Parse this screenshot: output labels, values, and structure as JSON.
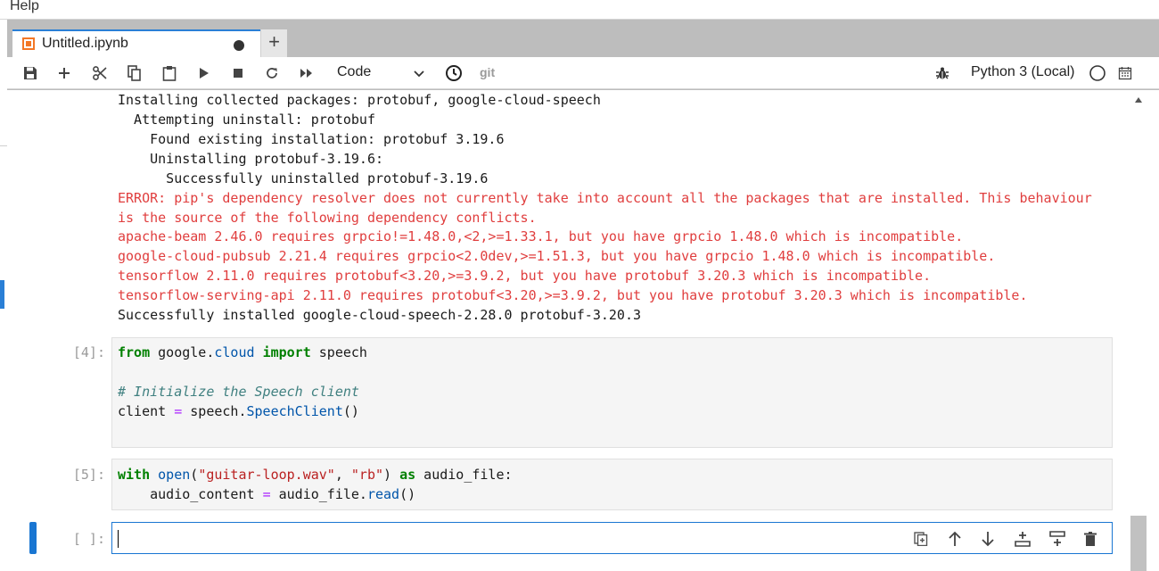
{
  "menu": {
    "help": "Help"
  },
  "tab": {
    "title": "Untitled.ipynb"
  },
  "toolbar": {
    "save": "save-icon",
    "add": "plus-icon",
    "cut": "scissors-icon",
    "copy": "copy-icon",
    "paste": "paste-icon",
    "run": "run-icon",
    "stop": "stop-icon",
    "restart": "restart-icon",
    "run_all": "fast-forward-icon",
    "cell_type": "Code",
    "git": "git",
    "kernel": "Python 3 (Local)"
  },
  "output": {
    "normal_lines": [
      "Installing collected packages: protobuf, google-cloud-speech",
      "  Attempting uninstall: protobuf",
      "    Found existing installation: protobuf 3.19.6",
      "    Uninstalling protobuf-3.19.6:",
      "      Successfully uninstalled protobuf-3.19.6"
    ],
    "error_lines": [
      "ERROR: pip's dependency resolver does not currently take into account all the packages that are installed. This behaviour",
      "is the source of the following dependency conflicts.",
      "apache-beam 2.46.0 requires grpcio!=1.48.0,<2,>=1.33.1, but you have grpcio 1.48.0 which is incompatible.",
      "google-cloud-pubsub 2.21.4 requires grpcio<2.0dev,>=1.51.3, but you have grpcio 1.48.0 which is incompatible.",
      "tensorflow 2.11.0 requires protobuf<3.20,>=3.9.2, but you have protobuf 3.20.3 which is incompatible.",
      "tensorflow-serving-api 2.11.0 requires protobuf<3.20,>=3.9.2, but you have protobuf 3.20.3 which is incompatible."
    ],
    "final_line": "Successfully installed google-cloud-speech-2.28.0 protobuf-3.20.3"
  },
  "cells": {
    "cell4": {
      "prompt": "[4]:",
      "l1": {
        "kw1": "from",
        "a": " google.",
        "nm1": "cloud",
        "b": " ",
        "kw2": "import",
        "c": " speech"
      },
      "comment": "# Initialize the Speech client",
      "l3": {
        "a": "client ",
        "op": "=",
        "b": " speech.",
        "nm": "SpeechClient",
        "c": "()"
      }
    },
    "cell5": {
      "prompt": "[5]:",
      "l1": {
        "kw1": "with",
        "a": " ",
        "nm1": "open",
        "b": "(",
        "s1": "\"guitar-loop.wav\"",
        "c": ", ",
        "s2": "\"rb\"",
        "d": ") ",
        "kw2": "as",
        "e": " audio_file:"
      },
      "l2": {
        "a": "    audio_content ",
        "op": "=",
        "b": " audio_file.",
        "nm": "read",
        "c": "()"
      }
    },
    "cell6": {
      "prompt": "[ ]:"
    }
  },
  "cell_tools": [
    "duplicate-icon",
    "move-up-icon",
    "move-down-icon",
    "insert-above-icon",
    "insert-below-icon",
    "delete-icon"
  ]
}
